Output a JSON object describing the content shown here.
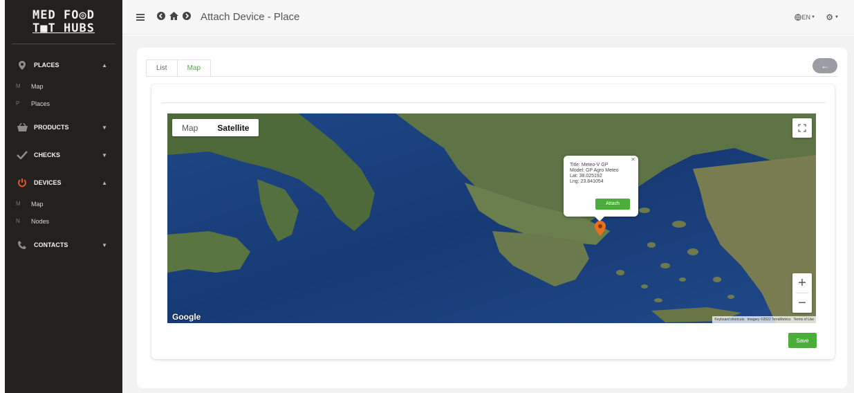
{
  "brand": {
    "line1": "MED FO◎D",
    "line2": "T■T HUBS"
  },
  "sidebar": {
    "sections": [
      {
        "label": "PLACES",
        "icon": "map-pin-icon",
        "subs": [
          {
            "key": "M",
            "label": "Map"
          },
          {
            "key": "P",
            "label": "Places"
          }
        ]
      },
      {
        "label": "PRODUCTS",
        "icon": "basket-icon"
      },
      {
        "label": "CHECKS",
        "icon": "check-icon"
      },
      {
        "label": "DEVICES",
        "icon": "power-icon",
        "accent": "#e8531c",
        "subs": [
          {
            "key": "M",
            "label": "Map"
          },
          {
            "key": "N",
            "label": "Nodes"
          }
        ]
      },
      {
        "label": "CONTACTS",
        "icon": "phone-icon"
      }
    ]
  },
  "header": {
    "title": "Attach Device - Place",
    "lang": "EN"
  },
  "tabs": [
    {
      "label": "List"
    },
    {
      "label": "Map"
    }
  ],
  "map": {
    "type_map": "Map",
    "type_satellite": "Satellite",
    "google": "Google",
    "attribution": {
      "shortcuts": "Keyboard shortcuts",
      "imagery": "Imagery ©2022 TerraMetrics",
      "terms": "Terms of Use"
    },
    "info": {
      "title_line": "Title: Meteo-V GP",
      "model_line": "Model: GP Agro Meteo",
      "lat_line": "Lat: 38.025192",
      "lng_line": "Lng: 23.841054",
      "attach": "Attach"
    }
  },
  "actions": {
    "save": "Save"
  },
  "colors": {
    "accent": "#4cae3a",
    "sidebar": "#232120",
    "pin": "#e8701c"
  }
}
